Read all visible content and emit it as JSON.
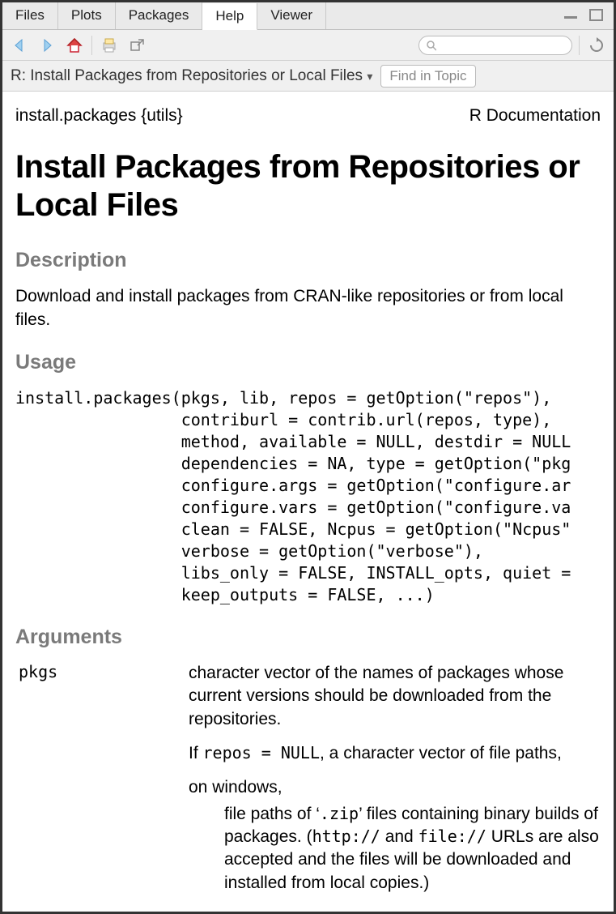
{
  "tabs": [
    "Files",
    "Plots",
    "Packages",
    "Help",
    "Viewer"
  ],
  "active_tab_index": 3,
  "subbar": {
    "breadcrumb": "R: Install Packages from Repositories or Local Files",
    "find_placeholder": "Find in Topic"
  },
  "search_placeholder": "",
  "doc": {
    "pkg_label": "install.packages {utils}",
    "doc_label": "R Documentation",
    "title": "Install Packages from Repositories or Local Files",
    "section_description": "Description",
    "description_text": "Download and install packages from CRAN-like repositories or from local files.",
    "section_usage": "Usage",
    "usage_code": "install.packages(pkgs, lib, repos = getOption(\"repos\"),\n                 contriburl = contrib.url(repos, type),\n                 method, available = NULL, destdir = NULL\n                 dependencies = NA, type = getOption(\"pkg\n                 configure.args = getOption(\"configure.ar\n                 configure.vars = getOption(\"configure.va\n                 clean = FALSE, Ncpus = getOption(\"Ncpus\"\n                 verbose = getOption(\"verbose\"),\n                 libs_only = FALSE, INSTALL_opts, quiet =\n                 keep_outputs = FALSE, ...)",
    "section_arguments": "Arguments",
    "arg1_name": "pkgs",
    "arg1_p1": "character vector of the names of packages whose current versions should be downloaded from the repositories.",
    "arg1_p2_pre": "If ",
    "arg1_p2_code": "repos = NULL",
    "arg1_p2_post": ", a character vector of file paths,",
    "arg1_p3": "on windows,",
    "arg1_p4_a": "file paths of ‘",
    "arg1_p4_code1": ".zip",
    "arg1_p4_b": "’ files containing binary builds of packages. (",
    "arg1_p4_code2": "http://",
    "arg1_p4_c": " and ",
    "arg1_p4_code3": "file://",
    "arg1_p4_d": " URLs are also accepted and the files will be downloaded and installed from local copies.)"
  }
}
